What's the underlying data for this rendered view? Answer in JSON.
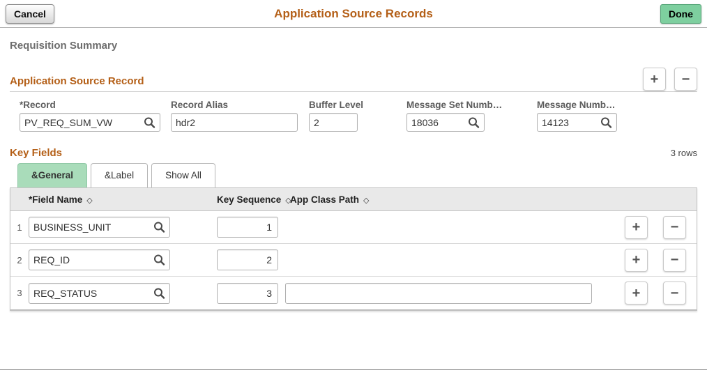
{
  "header": {
    "cancel_label": "Cancel",
    "title": "Application Source Records",
    "done_label": "Done"
  },
  "page": {
    "subtitle": "Requisition Summary"
  },
  "icons": {
    "add_icon": "+",
    "remove_icon": "−",
    "sort_icon": "◇"
  },
  "source_record": {
    "heading": "Application Source Record",
    "fields": {
      "record": {
        "label": "*Record",
        "value": "PV_REQ_SUM_VW"
      },
      "record_alias": {
        "label": "Record Alias",
        "value": "hdr2"
      },
      "buffer_level": {
        "label": "Buffer Level",
        "value": "2"
      },
      "message_set": {
        "label": "Message Set Numb…",
        "value": "18036"
      },
      "message_num": {
        "label": "Message Numb…",
        "value": "14123"
      }
    }
  },
  "key_fields": {
    "heading": "Key Fields",
    "row_count_label": "3 rows",
    "tabs": {
      "general": "&General",
      "label": "&Label",
      "show_all": "Show All"
    },
    "table": {
      "columns": {
        "field_name": "*Field Name",
        "key_sequence": "Key Sequence",
        "app_class_path": "App Class Path"
      },
      "rows": [
        {
          "num": "1",
          "field_name": "BUSINESS_UNIT",
          "key_sequence": "1"
        },
        {
          "num": "2",
          "field_name": "REQ_ID",
          "key_sequence": "2"
        },
        {
          "num": "3",
          "field_name": "REQ_STATUS",
          "key_sequence": "3",
          "app_class_path": ""
        }
      ]
    }
  },
  "colors": {
    "accent_orange": "#b45f17",
    "done_green": "#7ecf9f",
    "active_tab_green": "#a9dcba",
    "grid_header_gray": "#e9e9e9"
  }
}
